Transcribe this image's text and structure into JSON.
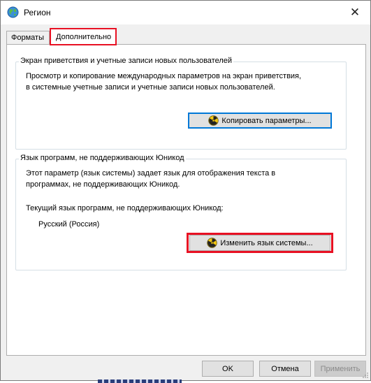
{
  "window": {
    "title": "Регион"
  },
  "tabs": [
    {
      "label": "Форматы",
      "selected": false
    },
    {
      "label": "Дополнительно",
      "selected": true
    }
  ],
  "welcome_group": {
    "legend": "Экран приветствия и учетные записи новых пользователей",
    "description_line1": "Просмотр и копирование международных параметров на экран приветствия,",
    "description_line2": "в системные учетные записи и учетные записи новых пользователей.",
    "copy_button_label": "Копировать параметры..."
  },
  "nonunicode_group": {
    "legend": "Язык программ, не поддерживающих Юникод",
    "description_line1": "Этот параметр (язык системы) задает язык для отображения текста в",
    "description_line2": "программах, не поддерживающих Юникод.",
    "current_label": "Текущий язык программ, не поддерживающих Юникод:",
    "current_value": "Русский (Россия)",
    "change_button_label": "Изменить язык системы..."
  },
  "footer": {
    "ok_label": "OK",
    "cancel_label": "Отмена",
    "apply_label": "Применить"
  },
  "colors": {
    "highlight": "#e81123",
    "focus": "#0078d7",
    "dialog_bg": "#f0f0f0"
  },
  "icons": {
    "title": "globe-icon",
    "uac": "uac-shield-icon",
    "close": "close-icon"
  }
}
